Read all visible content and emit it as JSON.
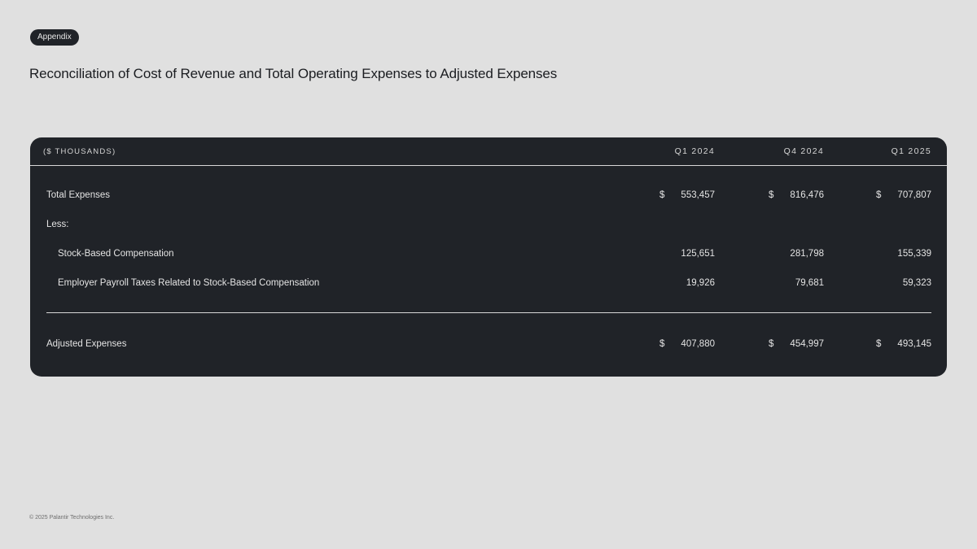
{
  "badge": "Appendix",
  "title": "Reconciliation of Cost of Revenue and Total Operating Expenses to Adjusted Expenses",
  "table": {
    "unit_label": "($ THOUSANDS)",
    "columns": [
      "Q1 2024",
      "Q4 2024",
      "Q1 2025"
    ],
    "rows": [
      {
        "label": "Total Expenses",
        "currency": "$",
        "values": [
          "553,457",
          "816,476",
          "707,807"
        ]
      },
      {
        "label": "Less:",
        "currency": "",
        "values": [
          "",
          "",
          ""
        ]
      },
      {
        "label": "Stock-Based Compensation",
        "currency": "",
        "values": [
          "125,651",
          "281,798",
          "155,339"
        ]
      },
      {
        "label": "Employer Payroll Taxes Related to Stock-Based Compensation",
        "currency": "",
        "values": [
          "19,926",
          "79,681",
          "59,323"
        ]
      }
    ],
    "total": {
      "label": "Adjusted Expenses",
      "currency": "$",
      "values": [
        "407,880",
        "454,997",
        "493,145"
      ]
    }
  },
  "footer": "© 2025 Palantir Technologies Inc.",
  "colors": {
    "background": "#e0e0e0",
    "panel": "#202328",
    "text_light": "#e4e4e4",
    "text_dark": "#1b1d21"
  }
}
